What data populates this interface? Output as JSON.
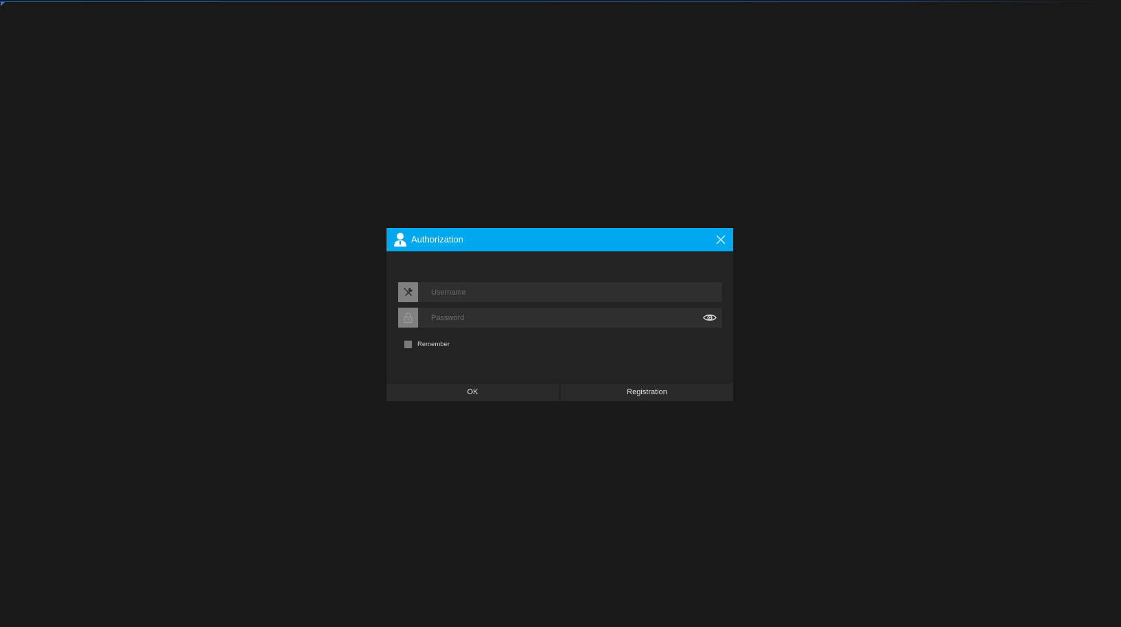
{
  "dialog": {
    "title": "Authorization",
    "title_icon": "user-icon",
    "close_icon": "close-icon",
    "accent_color": "#00a8f0"
  },
  "username": {
    "icon": "tools-icon",
    "value": "",
    "placeholder": "Username"
  },
  "password": {
    "icon": "lock-icon",
    "value": "",
    "placeholder": "Password",
    "reveal_icon": "eye-icon"
  },
  "remember": {
    "label": "Remember",
    "checked": false
  },
  "buttons": {
    "ok_label": "OK",
    "registration_label": "Registration"
  }
}
